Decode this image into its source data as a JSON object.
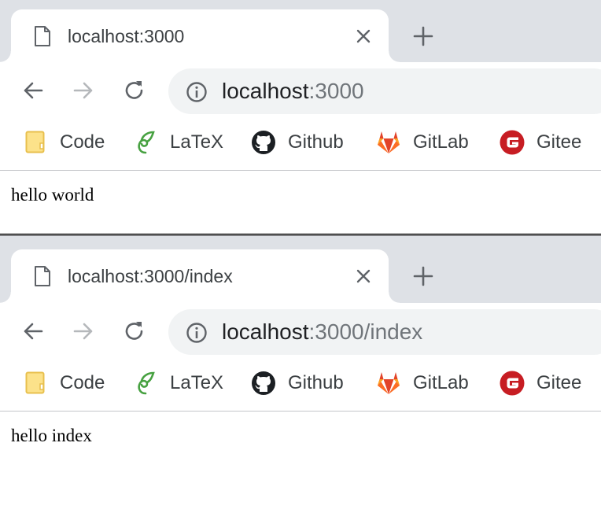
{
  "windows": [
    {
      "tab_title": "localhost:3000",
      "url_host": "localhost",
      "url_rest": ":3000",
      "page_text": "hello world"
    },
    {
      "tab_title": "localhost:3000/index",
      "url_host": "localhost",
      "url_rest": ":3000/index",
      "page_text": "hello index"
    }
  ],
  "bookmarks": [
    {
      "label": "Code",
      "icon": "folder-icon"
    },
    {
      "label": "LaTeX",
      "icon": "overleaf-icon"
    },
    {
      "label": "Github",
      "icon": "github-icon"
    },
    {
      "label": "GitLab",
      "icon": "gitlab-icon"
    },
    {
      "label": "Gitee",
      "icon": "gitee-icon"
    }
  ],
  "colors": {
    "tabstrip": "#dee1e6",
    "omnibox": "#f1f3f4",
    "folder": "#fce28a",
    "overleaf": "#47a141",
    "gitlab": "#fc6d26",
    "gitee": "#c71d23"
  }
}
